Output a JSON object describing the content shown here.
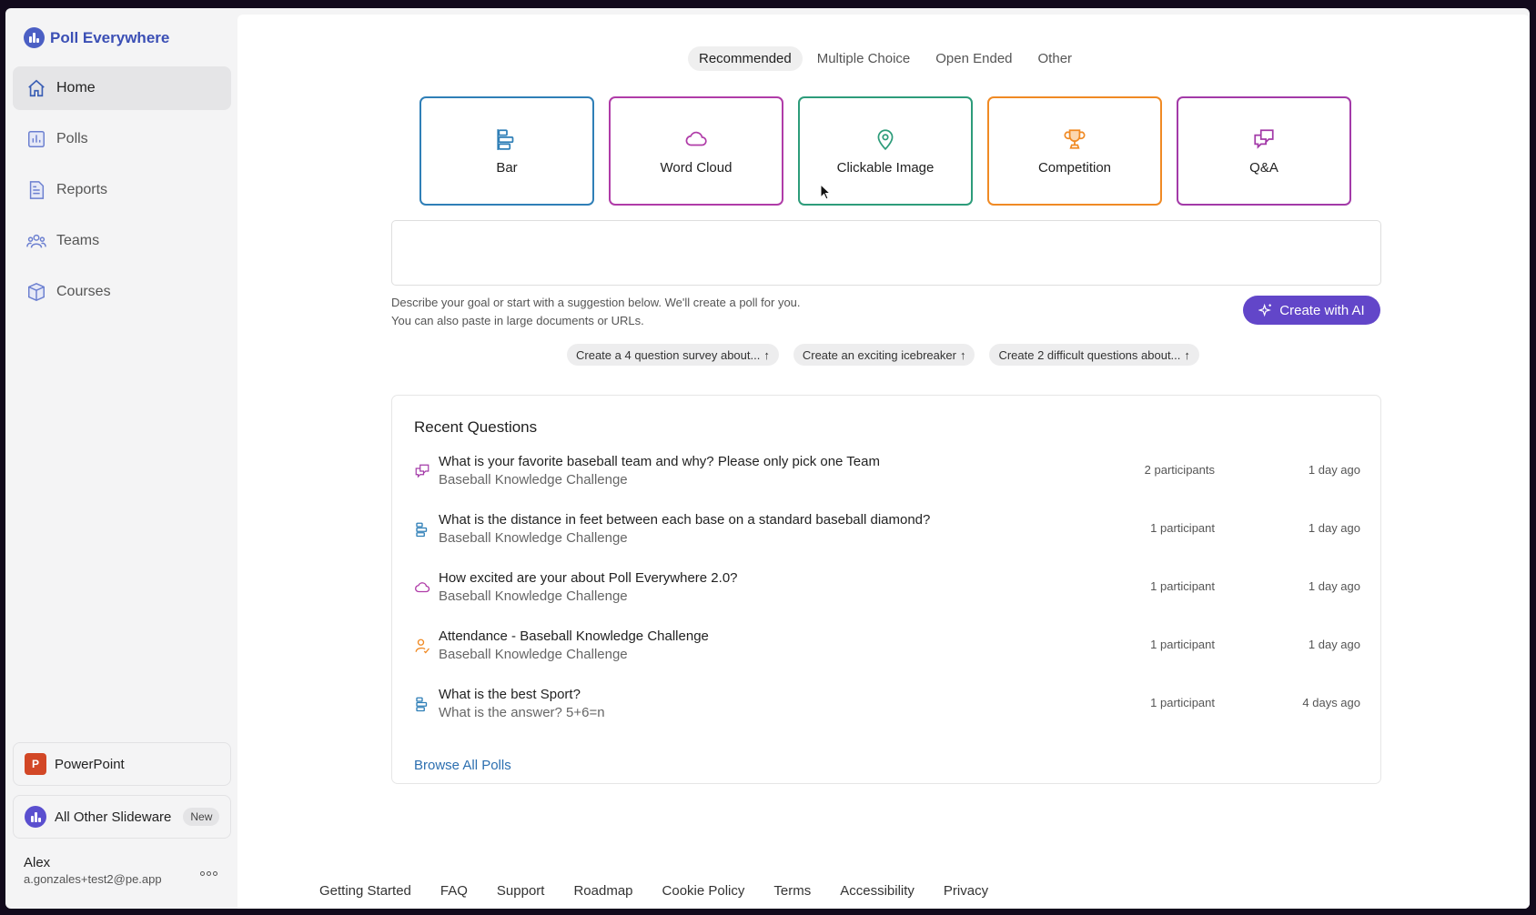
{
  "brand": {
    "name": "Poll Everywhere"
  },
  "sidebar": {
    "items": [
      {
        "label": "Home",
        "icon": "home-icon",
        "active": true
      },
      {
        "label": "Polls",
        "icon": "polls-icon"
      },
      {
        "label": "Reports",
        "icon": "reports-icon"
      },
      {
        "label": "Teams",
        "icon": "teams-icon"
      },
      {
        "label": "Courses",
        "icon": "courses-icon"
      }
    ],
    "powerpoint": {
      "label": "PowerPoint",
      "icon_text": "P"
    },
    "slideware": {
      "label": "All Other Slideware",
      "badge": "New"
    },
    "user": {
      "name": "Alex",
      "email": "a.gonzales+test2@pe.app"
    }
  },
  "tabs": [
    "Recommended",
    "Multiple Choice",
    "Open Ended",
    "Other"
  ],
  "poll_types": [
    {
      "label": "Bar",
      "icon": "bar-chart-icon",
      "color": "#2f7fb7"
    },
    {
      "label": "Word Cloud",
      "icon": "cloud-icon",
      "color": "#b03ca8"
    },
    {
      "label": "Clickable Image",
      "icon": "map-pin-icon",
      "color": "#2d9c7a"
    },
    {
      "label": "Competition",
      "icon": "trophy-icon",
      "color": "#f08a24"
    },
    {
      "label": "Q&A",
      "icon": "chat-bubbles-icon",
      "color": "#a33aa8"
    }
  ],
  "prompt": {
    "hint_line1": "Describe your goal or start with a suggestion below. We'll create a poll for you.",
    "hint_line2": "You can also paste in large documents or URLs.",
    "ai_button": "Create with AI"
  },
  "suggestions": [
    "Create a 4 question survey about...",
    "Create an exciting icebreaker",
    "Create 2 difficult questions about..."
  ],
  "recent": {
    "title": "Recent Questions",
    "rows": [
      {
        "title": "What is your favorite baseball team and why? Please only pick one Team",
        "sub": "Baseball Knowledge Challenge",
        "participants": "2 participants",
        "time": "1 day ago",
        "icon": "qa-icon"
      },
      {
        "title": "What is the distance in feet between each base on a standard baseball diamond?",
        "sub": "Baseball Knowledge Challenge",
        "participants": "1 participant",
        "time": "1 day ago",
        "icon": "bar-chart-icon"
      },
      {
        "title": "How excited are your about Poll Everywhere 2.0?",
        "sub": "Baseball Knowledge Challenge",
        "participants": "1 participant",
        "time": "1 day ago",
        "icon": "cloud-icon"
      },
      {
        "title": "Attendance - Baseball Knowledge Challenge",
        "sub": "Baseball Knowledge Challenge",
        "participants": "1 participant",
        "time": "1 day ago",
        "icon": "attendance-icon"
      },
      {
        "title": "What is the best Sport?",
        "sub": "What is the answer? 5+6=n",
        "participants": "1 participant",
        "time": "4 days ago",
        "icon": "bar-chart-icon"
      }
    ],
    "browse_label": "Browse All Polls"
  },
  "footer": [
    "Getting Started",
    "FAQ",
    "Support",
    "Roadmap",
    "Cookie Policy",
    "Terms",
    "Accessibility",
    "Privacy"
  ]
}
